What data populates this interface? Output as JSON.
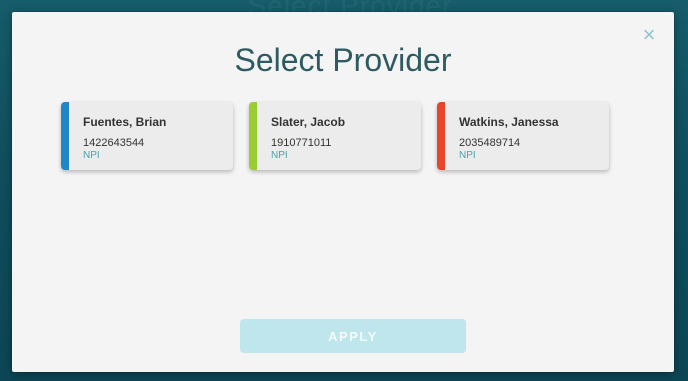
{
  "background": {
    "ghost_title": "Select Provider"
  },
  "modal": {
    "title": "Select Provider",
    "close_label": "×",
    "apply_label": "APPLY"
  },
  "providers": [
    {
      "name": "Fuentes, Brian",
      "number": "1422643544",
      "id_type": "NPI",
      "color": "#1f86c8"
    },
    {
      "name": "Slater, Jacob",
      "number": "1910771011",
      "id_type": "NPI",
      "color": "#9acd32"
    },
    {
      "name": "Watkins, Janessa",
      "number": "2035489714",
      "id_type": "NPI",
      "color": "#e8452c"
    }
  ],
  "colors": {
    "accent": "#4aa3b1",
    "title": "#2e5b61",
    "apply_disabled": "#bfe6ec"
  }
}
